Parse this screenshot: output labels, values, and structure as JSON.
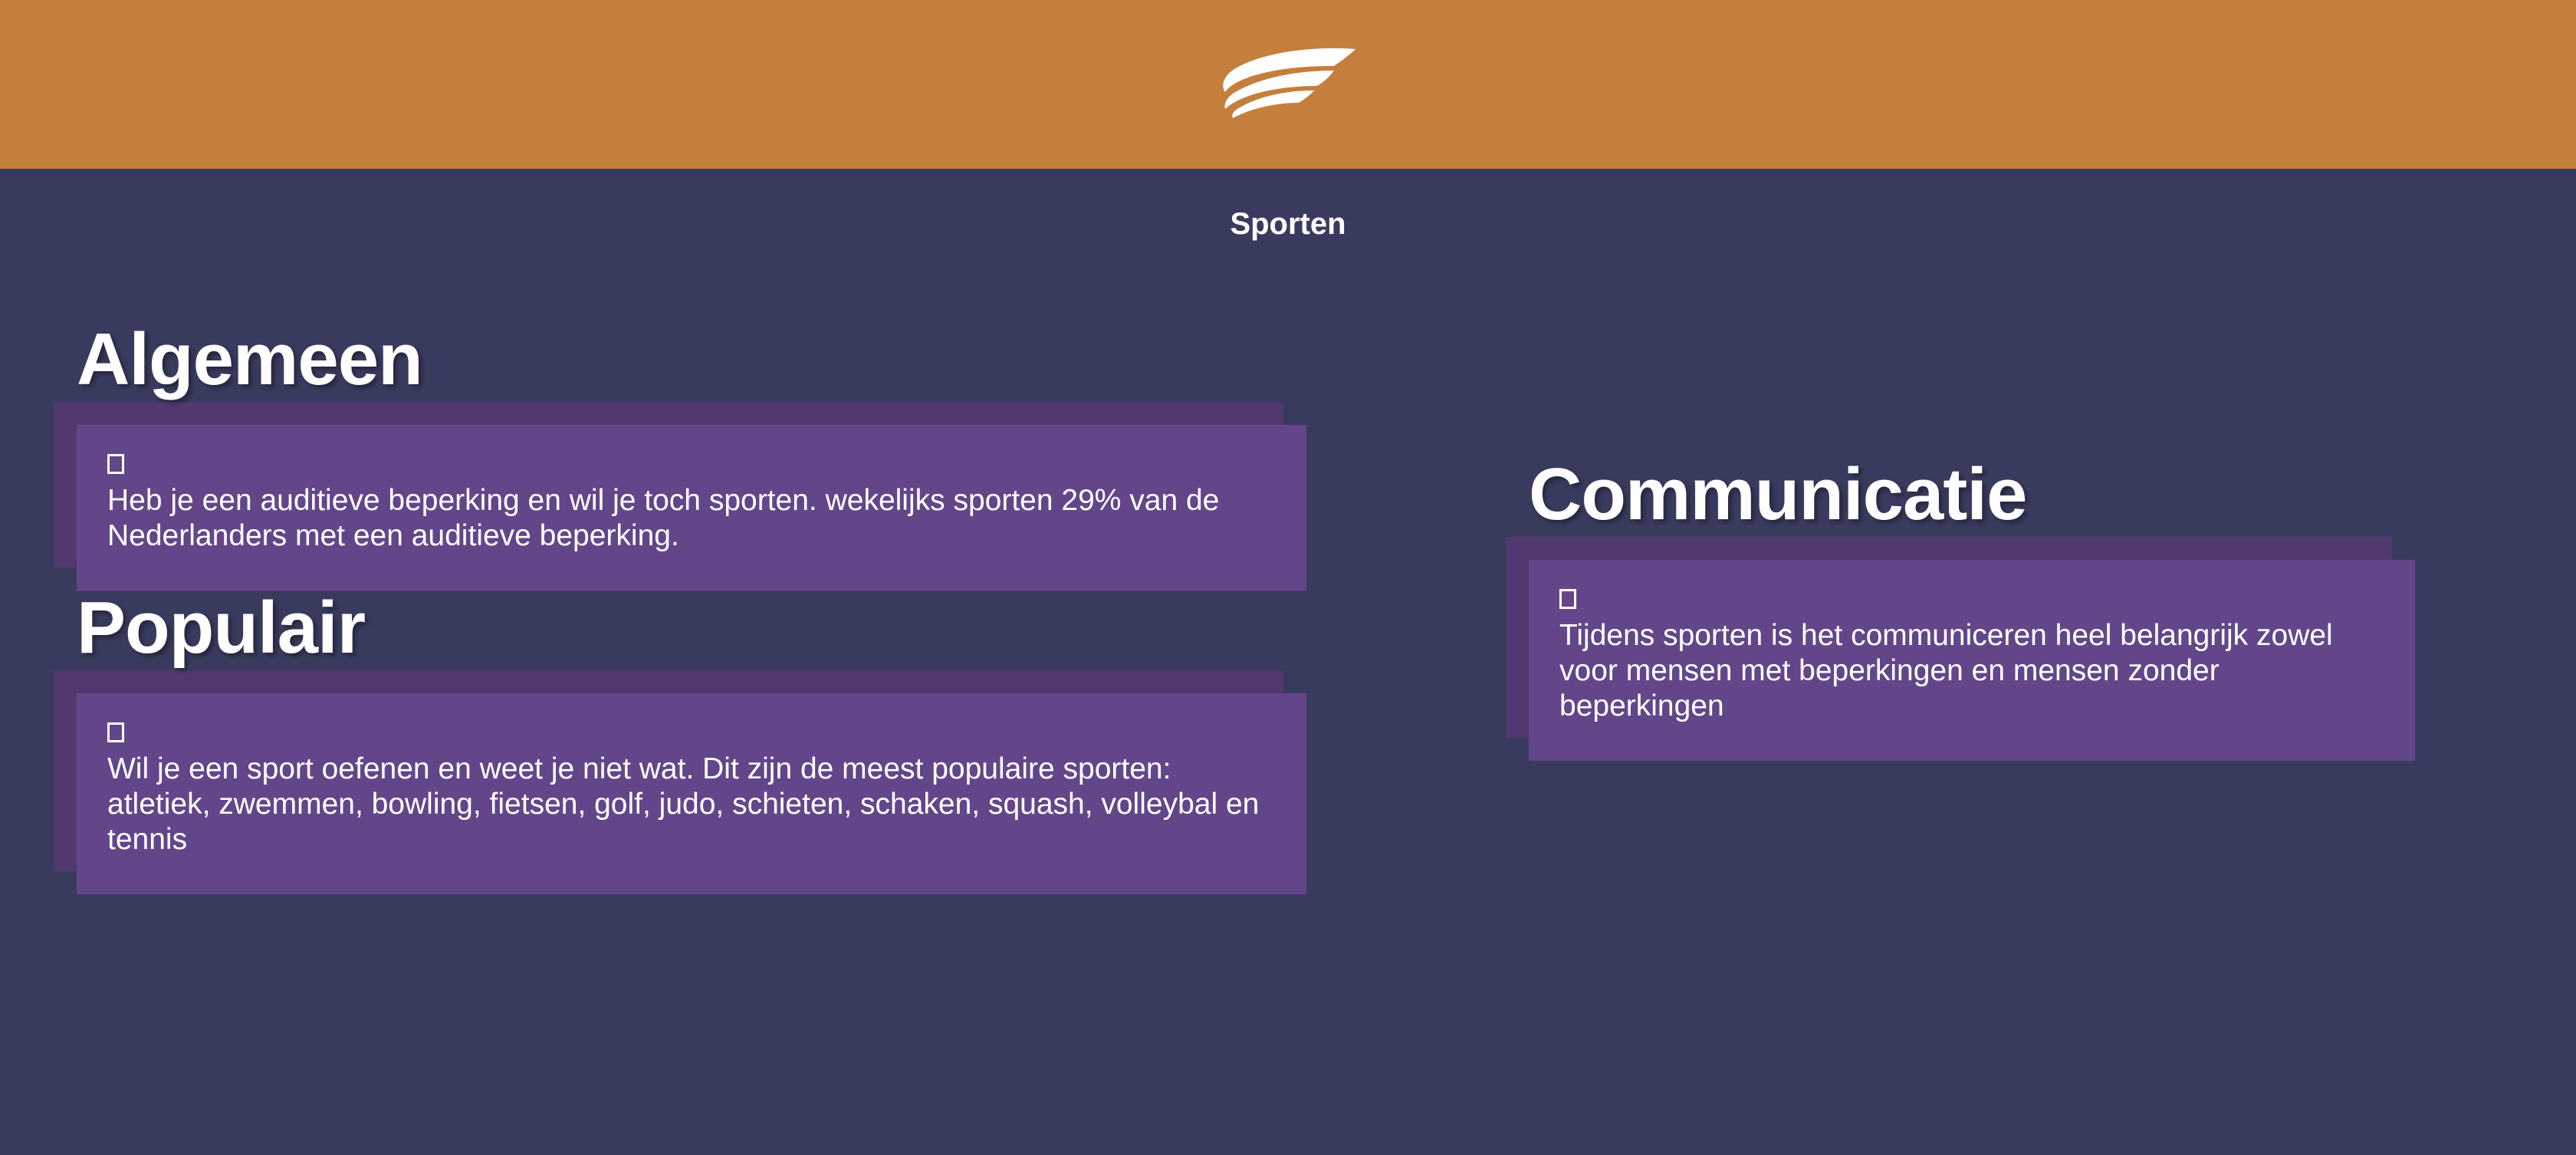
{
  "header": {
    "logo_icon": "wing-logo-icon",
    "background_color": "#C47F3C"
  },
  "nav": {
    "title": "Sporten"
  },
  "sections": {
    "algemeen": {
      "title": "Algemeen",
      "icon": "broken-image-icon",
      "text": "Heb je een auditieve beperking en wil je toch sporten. wekelijks sporten 29% van de Nederlanders met een auditieve beperking."
    },
    "populair": {
      "title": "Populair",
      "icon": "broken-image-icon",
      "text": "Wil je een sport oefenen en weet je niet wat. Dit zijn de meest populaire sporten: atletiek, zwemmen, bowling, fietsen, golf, judo, schieten, schaken, squash, volleybal en tennis"
    },
    "communicatie": {
      "title": "Communicatie",
      "icon": "broken-image-icon",
      "text": "Tijdens sporten is het communiceren heel belangrijk zowel voor mensen met beperkingen en mensen zonder beperkingen"
    }
  },
  "colors": {
    "page_background": "#393B5E",
    "card_background": "#63468A",
    "card_shadow": "#51386F",
    "text": "#FFFFFF"
  }
}
